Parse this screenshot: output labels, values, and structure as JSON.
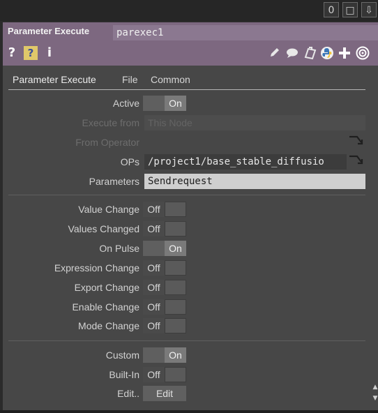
{
  "window": {
    "buttons": [
      "0",
      "□",
      "⇩"
    ]
  },
  "header": {
    "op_type": "Parameter Execute",
    "op_name": "parexec1",
    "left_icons": [
      "help-icon",
      "python-help-icon",
      "info-icon"
    ],
    "right_icons": [
      "pencil-icon",
      "comment-icon",
      "clone-icon",
      "python-icon",
      "add-icon",
      "target-icon"
    ]
  },
  "tabs": [
    "Parameter Execute",
    "File",
    "Common"
  ],
  "params": {
    "active": {
      "label": "Active",
      "value": "On"
    },
    "execute_from": {
      "label": "Execute from",
      "value": "This Node"
    },
    "from_operator": {
      "label": "From Operator",
      "value": ""
    },
    "ops": {
      "label": "OPs",
      "value": "/project1/base_stable_diffusio"
    },
    "parameters": {
      "label": "Parameters",
      "value": "Sendrequest"
    },
    "value_change": {
      "label": "Value Change",
      "value": "Off"
    },
    "values_changed": {
      "label": "Values Changed",
      "value": "Off"
    },
    "on_pulse": {
      "label": "On Pulse",
      "value": "On"
    },
    "expression_change": {
      "label": "Expression Change",
      "value": "Off"
    },
    "export_change": {
      "label": "Export Change",
      "value": "Off"
    },
    "enable_change": {
      "label": "Enable Change",
      "value": "Off"
    },
    "mode_change": {
      "label": "Mode Change",
      "value": "Off"
    },
    "custom": {
      "label": "Custom",
      "value": "On"
    },
    "built_in": {
      "label": "Built-In",
      "value": "Off"
    },
    "edit": {
      "label": "Edit..",
      "value": "Edit"
    }
  }
}
